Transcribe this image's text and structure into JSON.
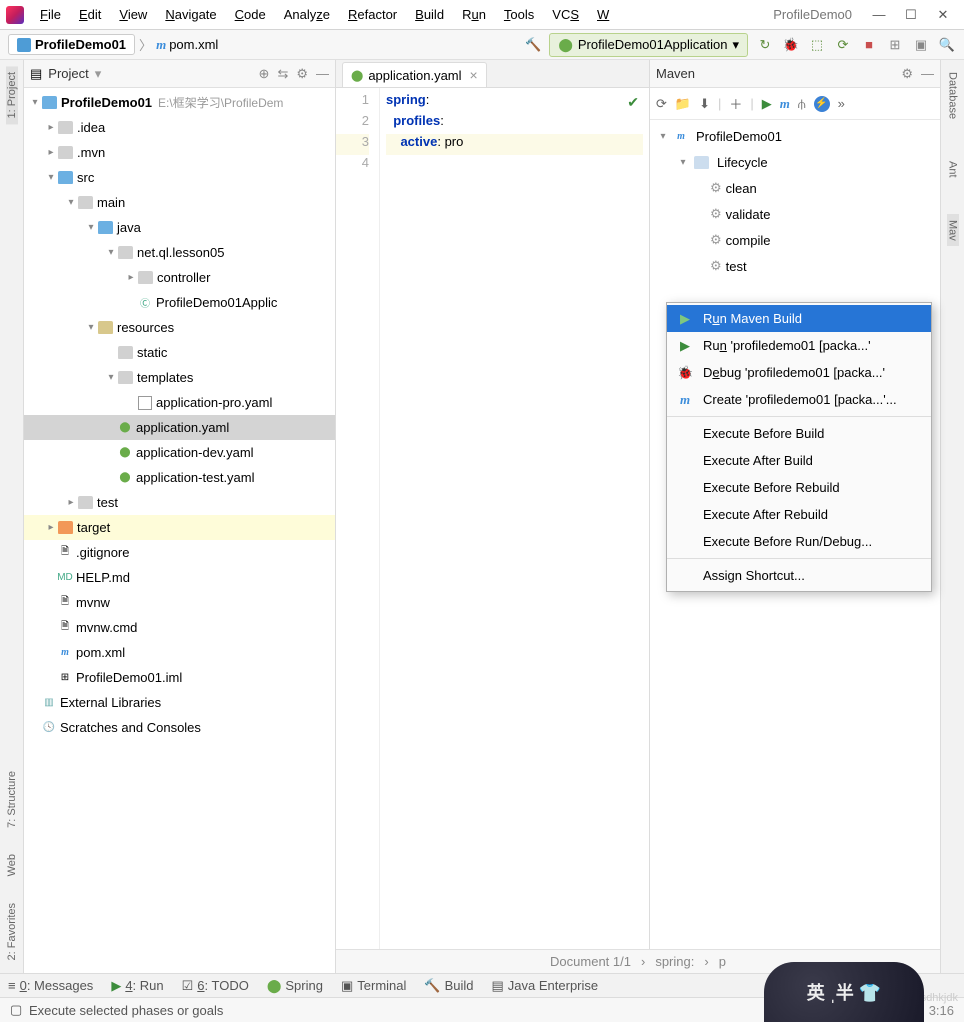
{
  "window": {
    "title": "ProfileDemo0"
  },
  "menubar": [
    "File",
    "Edit",
    "View",
    "Navigate",
    "Code",
    "Analyze",
    "Refactor",
    "Build",
    "Run",
    "Tools",
    "VCS",
    "W"
  ],
  "breadcrumb": {
    "project": "ProfileDemo01",
    "file": "pom.xml"
  },
  "runConfig": "ProfileDemo01Application",
  "projectPanel": {
    "title": "Project",
    "root": {
      "name": "ProfileDemo01",
      "path": "E:\\框架学习\\ProfileDem"
    },
    "nodes": {
      "idea": ".idea",
      "mvn": ".mvn",
      "src": "src",
      "main": "main",
      "java": "java",
      "pkg": "net.ql.lesson05",
      "controller": "controller",
      "app": "ProfileDemo01Applic",
      "resources": "resources",
      "static": "static",
      "templates": "templates",
      "yaml_pro": "application-pro.yaml",
      "yaml_main": "application.yaml",
      "yaml_dev": "application-dev.yaml",
      "yaml_test": "application-test.yaml",
      "test": "test",
      "target": "target",
      "gitignore": ".gitignore",
      "help": "HELP.md",
      "mvnw": "mvnw",
      "mvnwcmd": "mvnw.cmd",
      "pom": "pom.xml",
      "iml": "ProfileDemo01.iml",
      "ext": "External Libraries",
      "scratch": "Scratches and Consoles"
    }
  },
  "editor": {
    "tab": "application.yaml",
    "lines": [
      "spring:",
      "profiles:",
      "active: pro",
      ""
    ],
    "code": {
      "k1": "spring",
      "k2": "profiles",
      "k3": "active",
      "v3": "pro"
    }
  },
  "maven": {
    "title": "Maven",
    "project": "ProfileDemo01",
    "lifecycle": "Lifecycle",
    "goals": [
      "clean",
      "validate",
      "compile",
      "test"
    ]
  },
  "contextMenu": {
    "items": [
      {
        "label": "Run Maven Build",
        "icon": "run",
        "sel": true,
        "u": "u"
      },
      {
        "label": "Run 'profiledemo01 [packa...'",
        "icon": "run",
        "u": "n"
      },
      {
        "label": "Debug 'profiledemo01 [packa...'",
        "icon": "bug",
        "u": "e"
      },
      {
        "label": "Create 'profiledemo01 [packa...'...",
        "icon": "m"
      }
    ],
    "execs": [
      "Execute Before Build",
      "Execute After Build",
      "Execute Before Rebuild",
      "Execute After Rebuild",
      "Execute Before Run/Debug..."
    ],
    "assign": "Assign Shortcut..."
  },
  "breadcrumbBar": {
    "doc": "Document 1/1",
    "p1": "spring:",
    "p2": "p"
  },
  "bottomTools": {
    "a": "0: Messages",
    "b": "4: Run",
    "c": "6: TODO",
    "d": "Spring",
    "e": "Terminal",
    "f": "Build",
    "g": "Java Enterprise"
  },
  "status": {
    "msg": "Execute selected phases or goals",
    "pos": "3:16"
  },
  "sideStrips": {
    "project": "1: Project",
    "structure": "7: Structure",
    "web": "Web",
    "fav": "2: Favorites",
    "db": "Database",
    "ant": "Ant",
    "mvn": "Mav"
  },
  "watermark": "https://blog.csdn.net/asdhkjdk"
}
